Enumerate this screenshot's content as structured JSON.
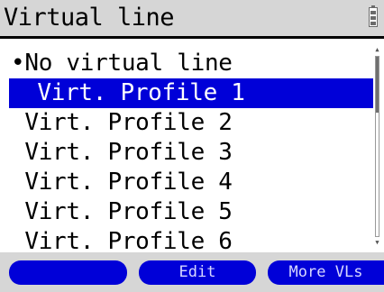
{
  "header": {
    "title": "Virtual line",
    "battery_icon": "battery-icon"
  },
  "list": {
    "items": [
      {
        "label": "•No virtual line",
        "selected": false
      },
      {
        "label": " Virt. Profile 1",
        "selected": true
      },
      {
        "label": " Virt. Profile 2",
        "selected": false
      },
      {
        "label": " Virt. Profile 3",
        "selected": false
      },
      {
        "label": " Virt. Profile 4",
        "selected": false
      },
      {
        "label": " Virt. Profile 5",
        "selected": false
      },
      {
        "label": " Virt. Profile 6",
        "selected": false
      }
    ]
  },
  "softkeys": {
    "left": "",
    "middle": "Edit",
    "right": "More VLs"
  },
  "colors": {
    "selection": "#0000d8",
    "bar_background": "#d6d6d6"
  }
}
